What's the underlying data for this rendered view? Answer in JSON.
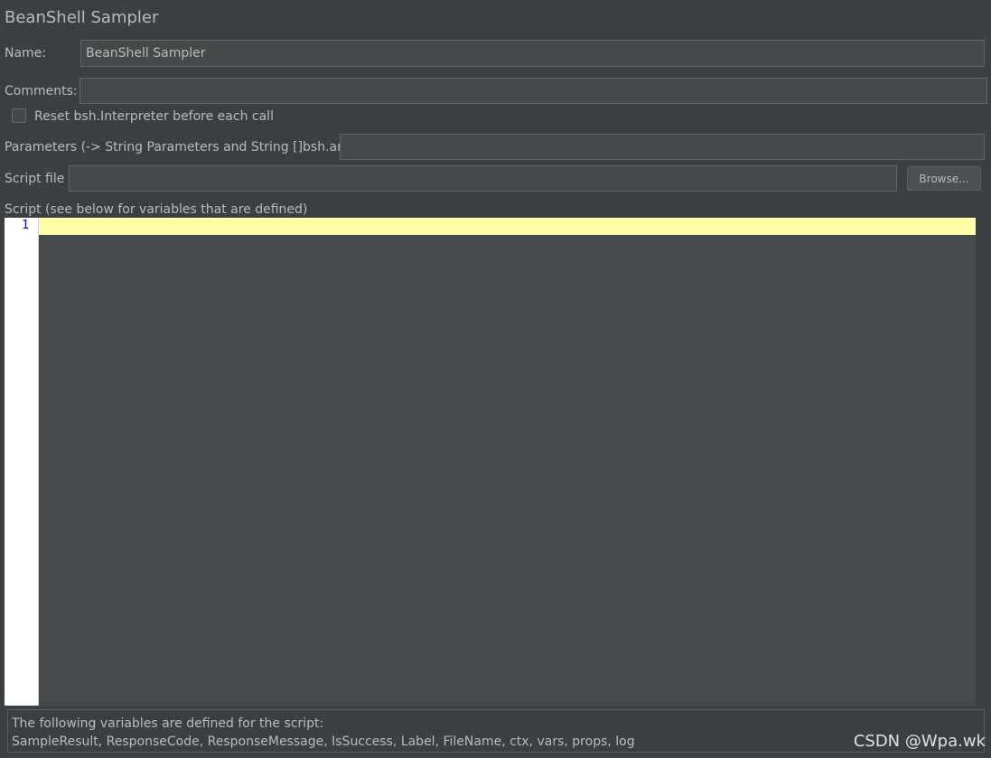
{
  "panel": {
    "title": "BeanShell Sampler"
  },
  "name": {
    "label": "Name:",
    "value": "BeanShell Sampler"
  },
  "comments": {
    "label": "Comments:",
    "value": ""
  },
  "reset_checkbox": {
    "label": "Reset bsh.Interpreter before each call",
    "checked": false
  },
  "parameters": {
    "label": "Parameters (-> String Parameters and String []bsh.args)",
    "value": ""
  },
  "script_file": {
    "label": "Script file",
    "value": "",
    "browse_label": "Browse..."
  },
  "script": {
    "label": "Script (see below for variables that are defined)",
    "line_numbers": [
      "1"
    ],
    "content": ""
  },
  "variables_info": {
    "line1": "The following variables are defined for the script:",
    "line2": "SampleResult, ResponseCode, ResponseMessage, IsSuccess, Label, FileName, ctx, vars, props, log"
  },
  "watermark": "CSDN @Wpa.wk",
  "colors": {
    "background": "#3c3f41",
    "field_background": "#45494a",
    "editor_background": "#464a4b",
    "current_line_highlight": "#ffffaa",
    "line_number": "#0000cc"
  }
}
